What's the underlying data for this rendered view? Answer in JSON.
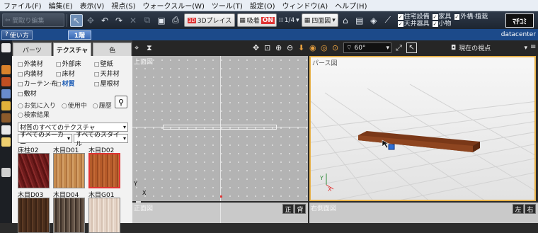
{
  "menu": [
    "ファイル(F)",
    "編集(E)",
    "表示(V)",
    "視点(S)",
    "ウォークスルー(W)",
    "ツール(T)",
    "設定(O)",
    "ウィンドウ(A)",
    "ヘルプ(H)"
  ],
  "toolbar": {
    "back_label": "間取り編集",
    "btn_3d_label": "3Dプレイス",
    "btn_3d_badge": "3D",
    "snap_label": "吸着",
    "snap_state": "ON",
    "grid_label": "1/4",
    "view_label": "四面図",
    "checks": [
      "住宅設備",
      "家具",
      "外構·植栽",
      "天井器具",
      "小物"
    ],
    "logo": "ﾏﾁｺﾐ"
  },
  "tabrow": {
    "how_to": "使い方",
    "floor_tab": "1階",
    "user": "datacenter"
  },
  "panel": {
    "tabs": [
      "パーツ",
      "テクスチャ",
      "色"
    ],
    "categories": [
      "外装材",
      "外部床",
      "壁紙",
      "内装材",
      "床材",
      "天井材",
      "カーテン·布",
      "材質",
      "屋根材",
      "敷材"
    ],
    "selected_category": "材質",
    "radios": [
      "お気に入り",
      "使用中",
      "履歴",
      "検索結果"
    ],
    "texture_select": "材質のすべてのテクスチャ",
    "maker_select": "すべてのメーカー",
    "style_select": "すべてのスタイル",
    "thumbs": [
      {
        "label": "床柱02",
        "color": "#6e1c1c"
      },
      {
        "label": "木目D01",
        "color": "#c58a4d"
      },
      {
        "label": "木目D02",
        "color": "#b65b2a"
      },
      {
        "label": "木目D03",
        "color": "#4a2e1c"
      },
      {
        "label": "木目D04",
        "color": "#7a6a5c"
      },
      {
        "label": "木目G01",
        "color": "#e4d3c6"
      }
    ]
  },
  "viewport": {
    "angle": "60°",
    "viewpoint_label": "現在の視点",
    "top_label": "上面図",
    "persp_label": "パース図",
    "front_label": "正面図",
    "right_label": "右側面図",
    "front_btns": [
      "正",
      "背"
    ],
    "right_btns": [
      "左",
      "右"
    ],
    "axis_x": "X",
    "axis_y": "Y"
  }
}
